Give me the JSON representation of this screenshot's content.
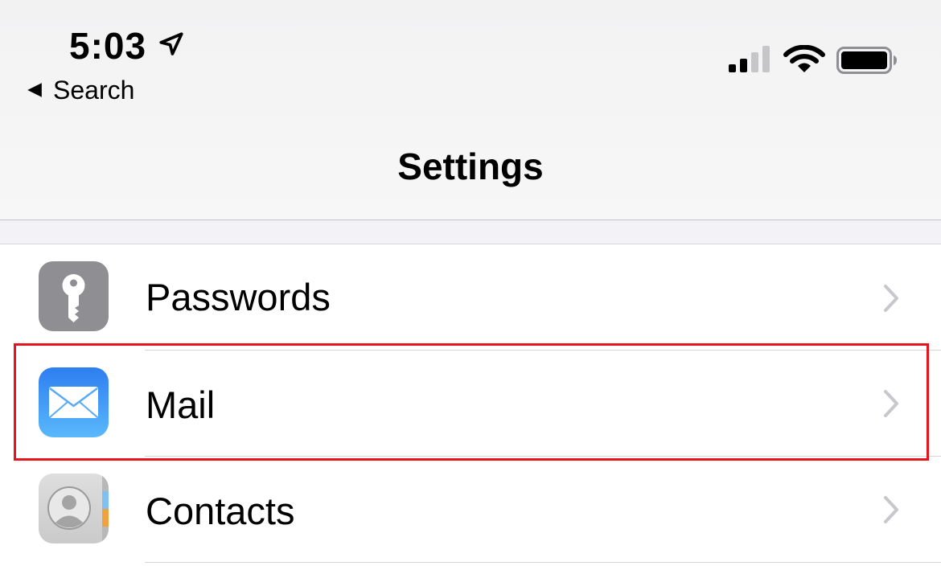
{
  "status_bar": {
    "time": "5:03",
    "icons": [
      "location-arrow-icon",
      "cellular-signal-icon",
      "wifi-icon",
      "battery-icon"
    ]
  },
  "nav": {
    "back_label": "Search",
    "title": "Settings"
  },
  "settings_rows": [
    {
      "label": "Passwords",
      "icon": "key-icon"
    },
    {
      "label": "Mail",
      "icon": "envelope-icon"
    },
    {
      "label": "Contacts",
      "icon": "contacts-icon"
    }
  ],
  "colors": {
    "highlight": "#e8141b",
    "passwords_icon": "#8e8e93",
    "mail_icon_top": "#2d7ef0",
    "mail_icon_bottom": "#5ab8fb",
    "contacts_icon": "#d4d4d4",
    "chevron": "#c7c7cc"
  }
}
